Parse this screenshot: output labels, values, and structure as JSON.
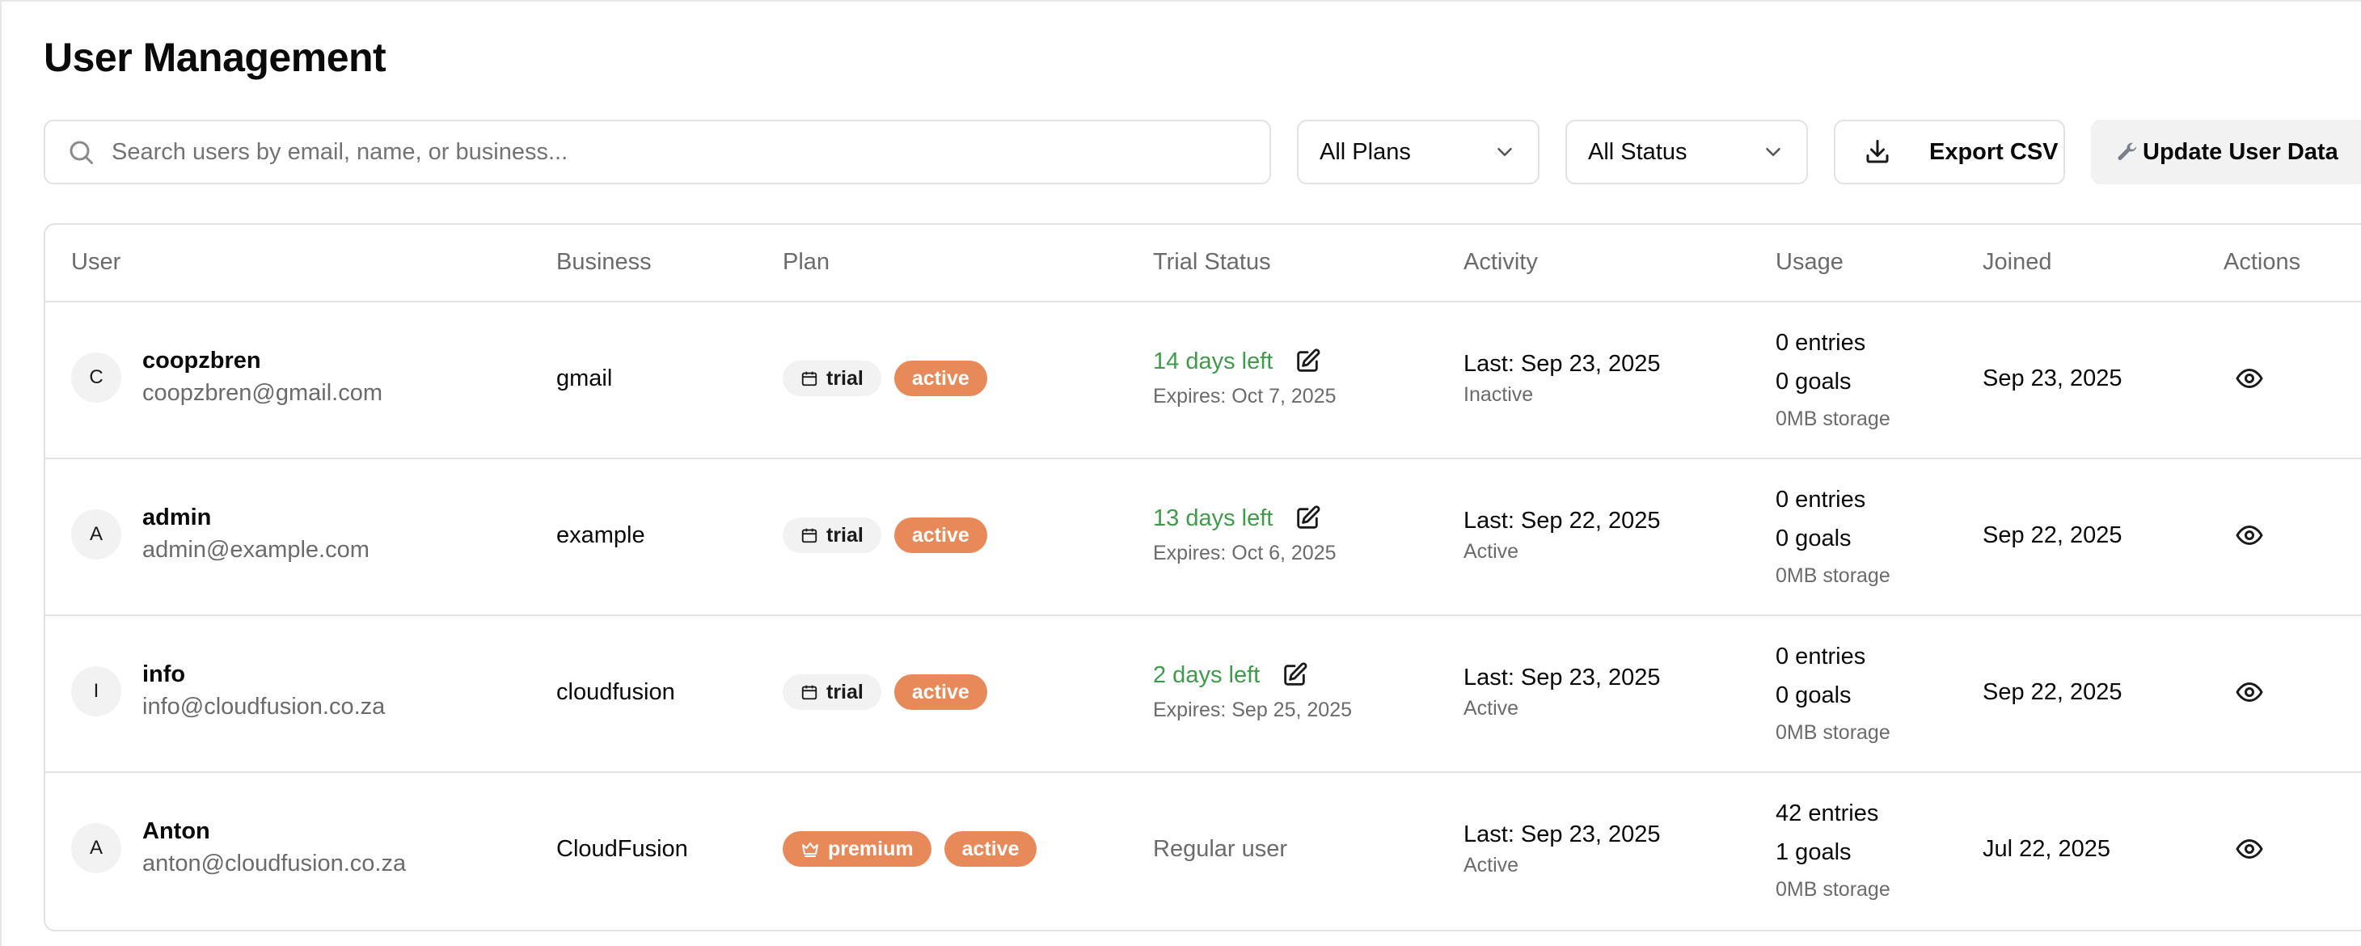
{
  "page": {
    "title": "User Management"
  },
  "toolbar": {
    "search_placeholder": "Search users by email, name, or business...",
    "plans_select": "All Plans",
    "status_select": "All Status",
    "export_label": "Export CSV",
    "update_label": "Update User Data"
  },
  "table": {
    "headers": [
      "User",
      "Business",
      "Plan",
      "Trial Status",
      "Activity",
      "Usage",
      "Joined",
      "Actions"
    ],
    "rows": [
      {
        "initial": "C",
        "name": "coopzbren",
        "email": "coopzbren@gmail.com",
        "business": "gmail",
        "plan": "trial",
        "status": "active",
        "trial_left": "14 days left",
        "trial_expires": "Expires: Oct 7, 2025",
        "last": "Last: Sep 23, 2025",
        "activity_state": "Inactive",
        "entries": "0 entries",
        "goals": "0 goals",
        "storage": "0MB storage",
        "joined": "Sep 23, 2025"
      },
      {
        "initial": "A",
        "name": "admin",
        "email": "admin@example.com",
        "business": "example",
        "plan": "trial",
        "status": "active",
        "trial_left": "13 days left",
        "trial_expires": "Expires: Oct 6, 2025",
        "last": "Last: Sep 22, 2025",
        "activity_state": "Active",
        "entries": "0 entries",
        "goals": "0 goals",
        "storage": "0MB storage",
        "joined": "Sep 22, 2025"
      },
      {
        "initial": "I",
        "name": "info",
        "email": "info@cloudfusion.co.za",
        "business": "cloudfusion",
        "plan": "trial",
        "status": "active",
        "trial_left": "2 days left",
        "trial_expires": "Expires: Sep 25, 2025",
        "last": "Last: Sep 23, 2025",
        "activity_state": "Active",
        "entries": "0 entries",
        "goals": "0 goals",
        "storage": "0MB storage",
        "joined": "Sep 22, 2025"
      },
      {
        "initial": "A",
        "name": "Anton",
        "email": "anton@cloudfusion.co.za",
        "business": "CloudFusion",
        "plan": "premium",
        "status": "active",
        "trial_regular": "Regular user",
        "last": "Last: Sep 23, 2025",
        "activity_state": "Active",
        "entries": "42 entries",
        "goals": "1 goals",
        "storage": "0MB storage",
        "joined": "Jul 22, 2025"
      }
    ]
  },
  "colors": {
    "accent": "#e8895a",
    "trial_green": "#3f9b4a",
    "muted": "#6b6b6b",
    "border": "#e2e2e2"
  },
  "icons": {
    "search": "search-icon",
    "chevron": "chevron-down-icon",
    "download": "download-icon",
    "wrench": "wrench-icon",
    "calendar": "calendar-icon",
    "crown": "crown-icon",
    "edit": "edit-icon",
    "eye": "eye-icon"
  }
}
